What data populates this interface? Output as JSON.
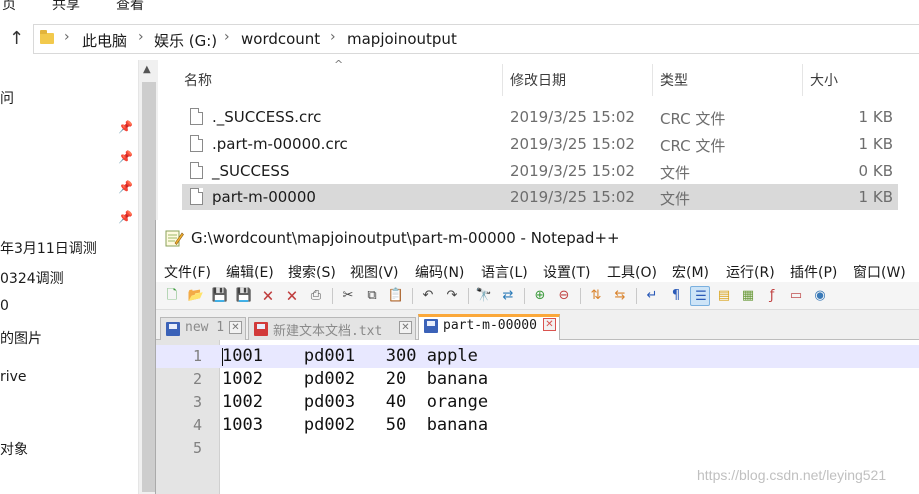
{
  "ribbon": {
    "tab_share": "共享",
    "tab_view": "查看",
    "tab_prev_fragment": "页"
  },
  "address_bar": {
    "crumbs": [
      "此电脑",
      "娱乐 (G:)",
      "wordcount",
      "mapjoinoutput"
    ]
  },
  "nav_pane": {
    "items": [
      "问",
      "年3月11日调测",
      "0324调测",
      "0",
      "的图片",
      "rive",
      "对象"
    ]
  },
  "file_list": {
    "columns": {
      "name": "名称",
      "modified": "修改日期",
      "type": "类型",
      "size": "大小"
    },
    "files": [
      {
        "name": "._SUCCESS.crc",
        "modified": "2019/3/25 15:02",
        "type": "CRC 文件",
        "size": "1 KB"
      },
      {
        "name": ".part-m-00000.crc",
        "modified": "2019/3/25 15:02",
        "type": "CRC 文件",
        "size": "1 KB"
      },
      {
        "name": "_SUCCESS",
        "modified": "2019/3/25 15:02",
        "type": "文件",
        "size": "0 KB"
      },
      {
        "name": "part-m-00000",
        "modified": "2019/3/25 15:02",
        "type": "文件",
        "size": "1 KB",
        "selected": true
      }
    ]
  },
  "notepad": {
    "title": "G:\\wordcount\\mapjoinoutput\\part-m-00000 - Notepad++",
    "menu": [
      "文件(F)",
      "编辑(E)",
      "搜索(S)",
      "视图(V)",
      "编码(N)",
      "语言(L)",
      "设置(T)",
      "工具(O)",
      "宏(M)",
      "运行(R)",
      "插件(P)",
      "窗口(W)"
    ],
    "toolbar_icons": [
      "new-file-icon",
      "open-file-icon",
      "save-icon",
      "save-all-icon",
      "close-icon",
      "close-all-icon",
      "print-icon",
      "cut-icon",
      "copy-icon",
      "paste-icon",
      "undo-icon",
      "redo-icon",
      "find-icon",
      "replace-icon",
      "zoom-in-icon",
      "zoom-out-icon",
      "sync-vertical-icon",
      "sync-horizontal-icon",
      "word-wrap-icon",
      "show-all-chars-icon",
      "indent-guide-icon",
      "fold-icon",
      "document-map-icon",
      "function-list-icon",
      "folder-workspace-icon",
      "monitor-icon"
    ],
    "tabs": [
      {
        "label": "new 1",
        "modified": false,
        "active": false
      },
      {
        "label": "新建文本文档.txt",
        "modified": true,
        "active": false
      },
      {
        "label": "part-m-00000",
        "modified": false,
        "active": true
      }
    ],
    "lines": [
      {
        "no": "1",
        "text": "1001    pd001   300 apple"
      },
      {
        "no": "2",
        "text": "1002    pd002   20  banana"
      },
      {
        "no": "3",
        "text": "1002    pd003   40  orange"
      },
      {
        "no": "4",
        "text": "1003    pd002   50  banana"
      },
      {
        "no": "5",
        "text": ""
      }
    ],
    "colors": {
      "current_line": "#e8e8ff",
      "active_tab_accent": "#fba83a",
      "gutter": "#e4e4e4"
    }
  },
  "watermark": "https://blog.csdn.net/leying521"
}
